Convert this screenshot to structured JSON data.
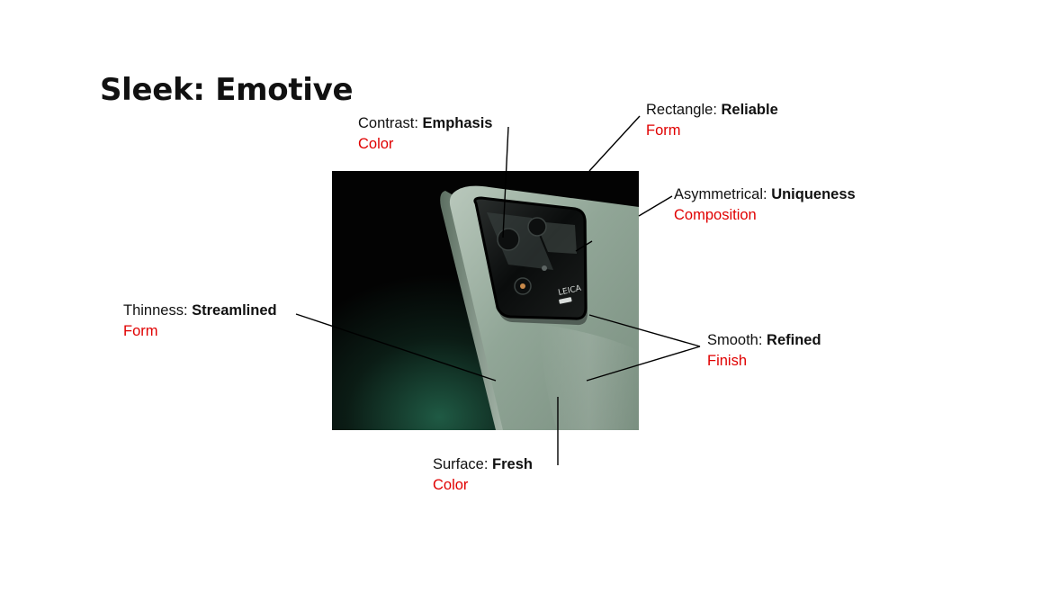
{
  "title": "Sleek: Emotive",
  "annotations": {
    "contrast": {
      "attribute": "Contrast",
      "quality": "Emphasis",
      "category": "Color"
    },
    "rectangle": {
      "attribute": "Rectangle",
      "quality": "Reliable",
      "category": "Form"
    },
    "asymmetrical": {
      "attribute": "Asymmetrical",
      "quality": "Uniqueness",
      "category": "Composition"
    },
    "thinness": {
      "attribute": "Thinness",
      "quality": "Streamlined",
      "category": "Form"
    },
    "smooth": {
      "attribute": "Smooth",
      "quality": "Refined",
      "category": "Finish"
    },
    "surface": {
      "attribute": "Surface",
      "quality": "Fresh",
      "category": "Color"
    }
  },
  "photo": {
    "logo_text": "LEICA"
  },
  "colors": {
    "category": "#e00000",
    "text": "#111111",
    "phone_body": "#8fa595",
    "background": "#050505"
  }
}
